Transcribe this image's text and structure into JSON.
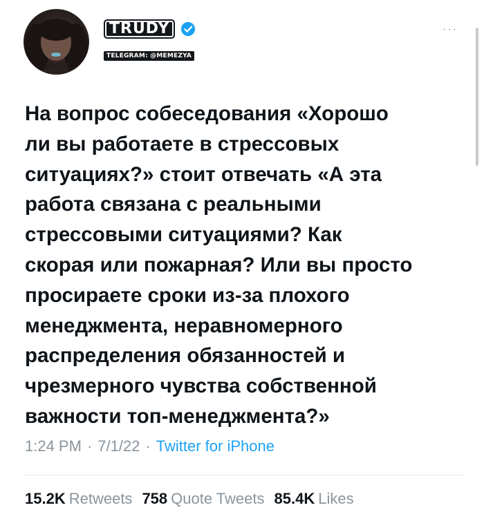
{
  "author": {
    "display_name": "TRUDY",
    "handle": "TELEGRAM: @MEMEZYA",
    "avatar_icon": "profile-avatar",
    "verified_icon": "verified-badge-icon"
  },
  "more_icon": "more-options-icon",
  "tweet": {
    "lines": [
      "На вопрос собеседования «Хорошо",
      "ли вы работаете в стрессовых",
      "ситуациях?» стоит отвечать «А эта",
      "работа связана с реальными",
      "стрессовыми ситуациями? Как",
      "скорая или пожарная? Или вы просто",
      "просираете сроки из-за плохого",
      "менеджмента, неравномерного",
      "распределения обязанностей и",
      "чрезмерного чувства собственной",
      "важности топ-менеджмента?»"
    ]
  },
  "meta": {
    "time": "1:24 PM",
    "date": "7/1/22",
    "separator": "·",
    "source": "Twitter for iPhone"
  },
  "stats": {
    "retweets_count": "15.2K",
    "retweets_label": "Retweets",
    "quotes_count": "758",
    "quotes_label": "Quote Tweets",
    "likes_count": "85.4K",
    "likes_label": "Likes"
  },
  "colors": {
    "verified": "#1da1f2",
    "link": "#1da1f2",
    "muted": "#8a949c",
    "text": "#0f1419"
  }
}
